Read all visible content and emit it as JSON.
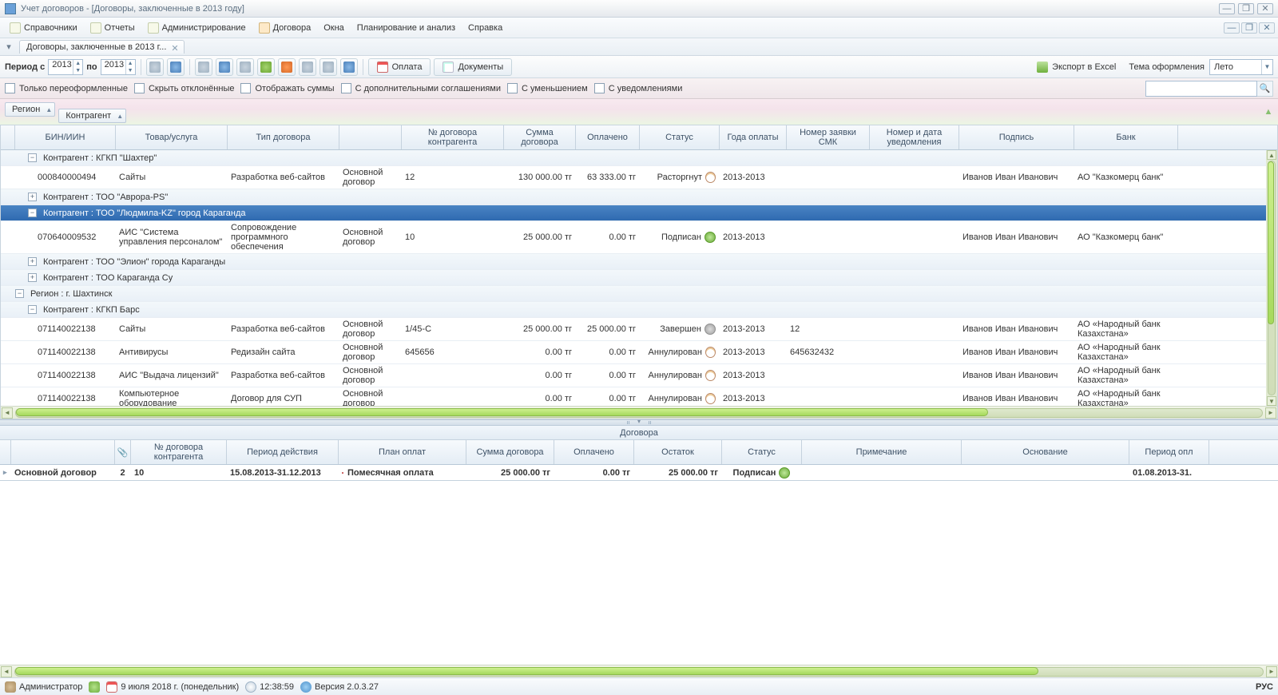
{
  "window": {
    "title": "Учет договоров - [Договоры, заключенные в 2013 году]"
  },
  "menu": [
    "Справочники",
    "Отчеты",
    "Администрирование",
    "Договора",
    "Окна",
    "Планирование и анализ",
    "Справка"
  ],
  "tab": "Договоры, заключенные в 2013 г...",
  "toolbar": {
    "period_from_lbl": "Период с",
    "period_to_lbl": "по",
    "from": "2013",
    "to": "2013",
    "pay_btn": "Оплата",
    "docs_btn": "Документы",
    "export_btn": "Экспорт в Excel",
    "theme_lbl": "Тема оформления",
    "theme_val": "Лето"
  },
  "filters": {
    "reissued": "Только переоформленные",
    "hide_rej": "Скрыть отклонённые",
    "show_sums": "Отображать суммы",
    "with_add": "С дополнительными соглашениями",
    "with_dec": "С уменьшением",
    "with_not": "С уведомлениями"
  },
  "group_pills": [
    "Регион",
    "Контрагент"
  ],
  "columns": [
    "БИН/ИИН",
    "Товар/услуга",
    "Тип договора",
    "",
    "№ договора контрагента",
    "Сумма договора",
    "Оплачено",
    "Статус",
    "Года оплаты",
    "Номер заявки СМК",
    "Номер и дата уведомления",
    "Подпись",
    "Банк"
  ],
  "groups": [
    {
      "level": 1,
      "exp": "-",
      "label": "Контрагент : КГКП \"Шахтер\""
    },
    {
      "row": {
        "bin": "000840000494",
        "good": "Сайты",
        "type": "Разработка веб-сайтов",
        "dtype": "Основной договор",
        "num": "12",
        "sum": "130 000.00 тг",
        "paid": "63 333.00 тг",
        "status": "Расторгнут",
        "sico": "doc",
        "years": "2013-2013",
        "smk": "",
        "notif": "",
        "sign": "Иванов Иван Иванович",
        "bank": "АО \"Казкомерц банк\""
      }
    },
    {
      "level": 1,
      "exp": "+",
      "label": "Контрагент : ТОО \"Аврора-PS\""
    },
    {
      "level": 1,
      "exp": "-",
      "label": "Контрагент : ТОО \"Людмила-KZ\" город Караганда",
      "sel": true
    },
    {
      "row": {
        "bin": "070640009532",
        "good": "АИС \"Система управления персоналом\"",
        "type": "Сопровождение программного обеспечения",
        "dtype": "Основной договор",
        "num": "10",
        "sum": "25 000.00 тг",
        "paid": "0.00 тг",
        "status": "Подписан",
        "sico": "grn",
        "years": "2013-2013",
        "smk": "",
        "notif": "",
        "sign": "Иванов Иван Иванович",
        "bank": "АО \"Казкомерц банк\""
      }
    },
    {
      "level": 1,
      "exp": "+",
      "label": "Контрагент : ТОО \"Элион\" города Караганды"
    },
    {
      "level": 1,
      "exp": "+",
      "label": "Контрагент : ТОО Караганда Су"
    },
    {
      "level": 0,
      "exp": "-",
      "label": "Регион : г. Шахтинск"
    },
    {
      "level": 1,
      "exp": "-",
      "label": "Контрагент : КГКП Барс"
    },
    {
      "row": {
        "bin": "071140022138",
        "good": "Сайты",
        "type": "Разработка веб-сайтов",
        "dtype": "Основной договор",
        "num": "1/45-С",
        "sum": "25 000.00 тг",
        "paid": "25 000.00 тг",
        "status": "Завершен",
        "sico": "gray",
        "years": "2013-2013",
        "smk": "12",
        "notif": "",
        "sign": "Иванов Иван Иванович",
        "bank": "АО «Народный банк Казахстана»"
      }
    },
    {
      "row": {
        "bin": "071140022138",
        "good": "Антивирусы",
        "type": "Редизайн сайта",
        "dtype": "Основной договор",
        "num": "645656",
        "sum": "0.00 тг",
        "paid": "0.00 тг",
        "status": "Аннулирован",
        "sico": "doc",
        "years": "2013-2013",
        "smk": "645632432",
        "notif": "",
        "sign": "Иванов Иван Иванович",
        "bank": "АО «Народный банк Казахстана»"
      }
    },
    {
      "row": {
        "bin": "071140022138",
        "good": "АИС \"Выдача лицензий\"",
        "type": "Разработка веб-сайтов",
        "dtype": "Основной договор",
        "num": "",
        "sum": "0.00 тг",
        "paid": "0.00 тг",
        "status": "Аннулирован",
        "sico": "doc",
        "years": "2013-2013",
        "smk": "",
        "notif": "",
        "sign": "Иванов Иван Иванович",
        "bank": "АО «Народный банк Казахстана»"
      }
    },
    {
      "row": {
        "bin": "071140022138",
        "good": "Компьютерное оборудование",
        "type": "Договор для СУП",
        "dtype": "Основной договор",
        "num": "",
        "sum": "0.00 тг",
        "paid": "0.00 тг",
        "status": "Аннулирован",
        "sico": "doc",
        "years": "2013-2013",
        "smk": "",
        "notif": "",
        "sign": "Иванов Иван Иванович",
        "bank": "АО «Народный банк Казахстана»"
      }
    }
  ],
  "detail_title": "Договора",
  "detail_cols": [
    "",
    "",
    "№ договора контрагента",
    "Период действия",
    "План оплат",
    "Сумма договора",
    "Оплачено",
    "Остаток",
    "Статус",
    "Примечание",
    "Основание",
    "Период опл"
  ],
  "detail_row": {
    "type": "Основной договор",
    "n": "2",
    "num": "10",
    "period": "15.08.2013-31.12.2013",
    "plan": "Помесячная оплата",
    "sum": "25 000.00 тг",
    "paid": "0.00 тг",
    "rest": "25 000.00 тг",
    "status": "Подписан",
    "note": "",
    "basis": "",
    "pperiod": "01.08.2013-31."
  },
  "status": {
    "user": "Администратор",
    "date": "9 июля 2018 г. (понедельник)",
    "time": "12:38:59",
    "ver": "Версия 2.0.3.27",
    "lang": "РУС"
  }
}
